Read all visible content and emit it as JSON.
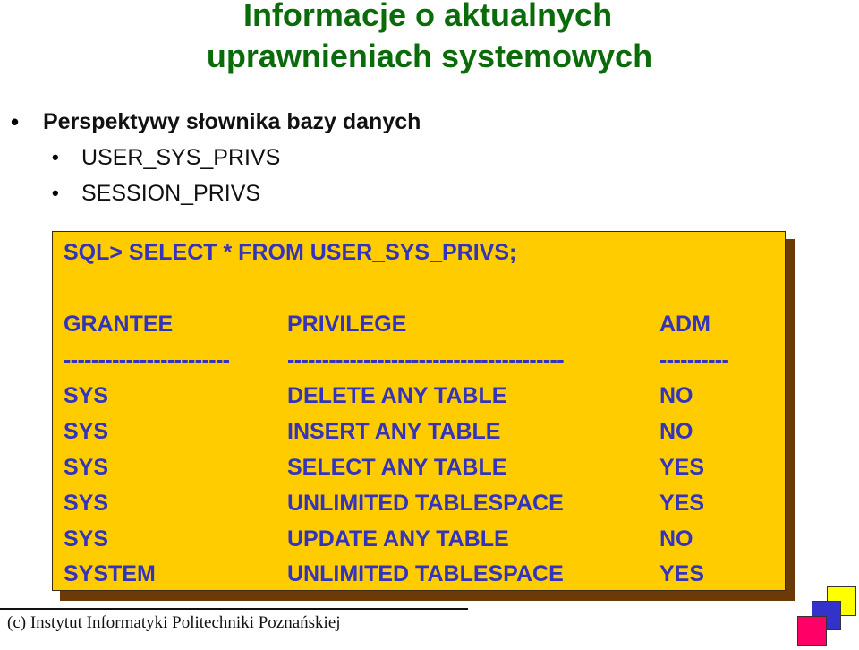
{
  "slide": {
    "title_lines": [
      "Informacje o aktualnych",
      "uprawnieniach systemowych"
    ],
    "bullets": [
      {
        "level": 1,
        "text": "Perspektywy słownika bazy danych"
      },
      {
        "level": 2,
        "text": "USER_SYS_PRIVS"
      },
      {
        "level": 2,
        "text": "SESSION_PRIVS"
      }
    ],
    "sql": {
      "query": "SQL> SELECT * FROM USER_SYS_PRIVS;",
      "headers": [
        "GRANTEE",
        "PRIVILEGE",
        "ADM"
      ],
      "separators": [
        "------------------------",
        "----------------------------------------",
        "----------"
      ],
      "rows": [
        [
          "SYS",
          "DELETE ANY TABLE",
          "NO"
        ],
        [
          "SYS",
          "INSERT ANY TABLE",
          "NO"
        ],
        [
          "SYS",
          "SELECT ANY TABLE",
          "YES"
        ],
        [
          "SYS",
          "UNLIMITED TABLESPACE",
          "YES"
        ],
        [
          "SYS",
          "UPDATE ANY TABLE",
          "NO"
        ],
        [
          "SYSTEM",
          "UNLIMITED TABLESPACE",
          "YES"
        ]
      ]
    },
    "footer": "(c) Instytut Informatyki Politechniki Poznańskiej",
    "colors": {
      "title": "#0b6b0b",
      "sql_background": "#ffcc00",
      "sql_text": "#3333bb",
      "sql_shadow": "#6b3a06",
      "logo_squares": [
        "#ffff00",
        "#3333cc",
        "#ff0066"
      ]
    }
  }
}
